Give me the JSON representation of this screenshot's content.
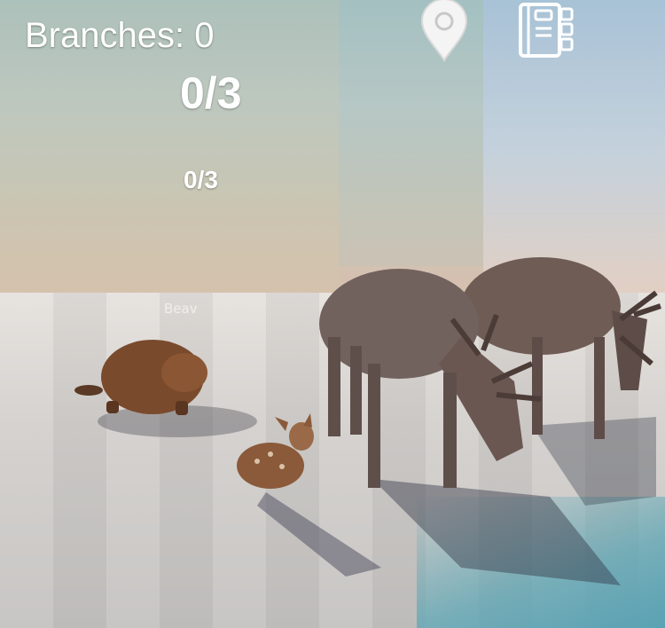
{
  "hud": {
    "branches_label": "Branches:",
    "branches_count": "0",
    "progress_primary": "0/3",
    "progress_secondary": "0/3",
    "dim_label": "Beav"
  },
  "icons": {
    "map": "map-pin-icon",
    "journal": "journal-icon"
  },
  "colors": {
    "hud_text": "#ffffff"
  }
}
